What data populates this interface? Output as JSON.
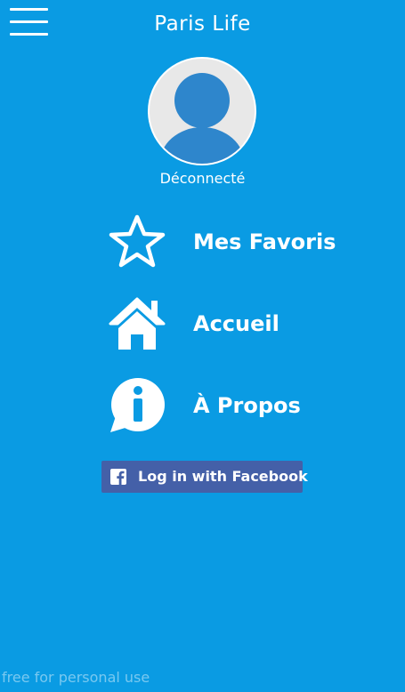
{
  "header": {
    "title": "Paris Life",
    "menu_icon": "hamburger-menu-icon"
  },
  "profile": {
    "avatar_icon": "user-avatar-icon",
    "status": "Déconnecté"
  },
  "menu": {
    "items": [
      {
        "label": "Mes Favoris",
        "icon": "star-icon"
      },
      {
        "label": "Accueil",
        "icon": "home-icon"
      },
      {
        "label": "À Propos",
        "icon": "info-bubble-icon"
      }
    ]
  },
  "facebook": {
    "label": "Log in with Facebook",
    "icon": "facebook-icon"
  },
  "watermark": "free for personal use",
  "colors": {
    "background": "#0a9be3",
    "facebook": "#4460a8",
    "avatar_bg": "#e8e8e8",
    "avatar_figure": "#2e86cc"
  }
}
